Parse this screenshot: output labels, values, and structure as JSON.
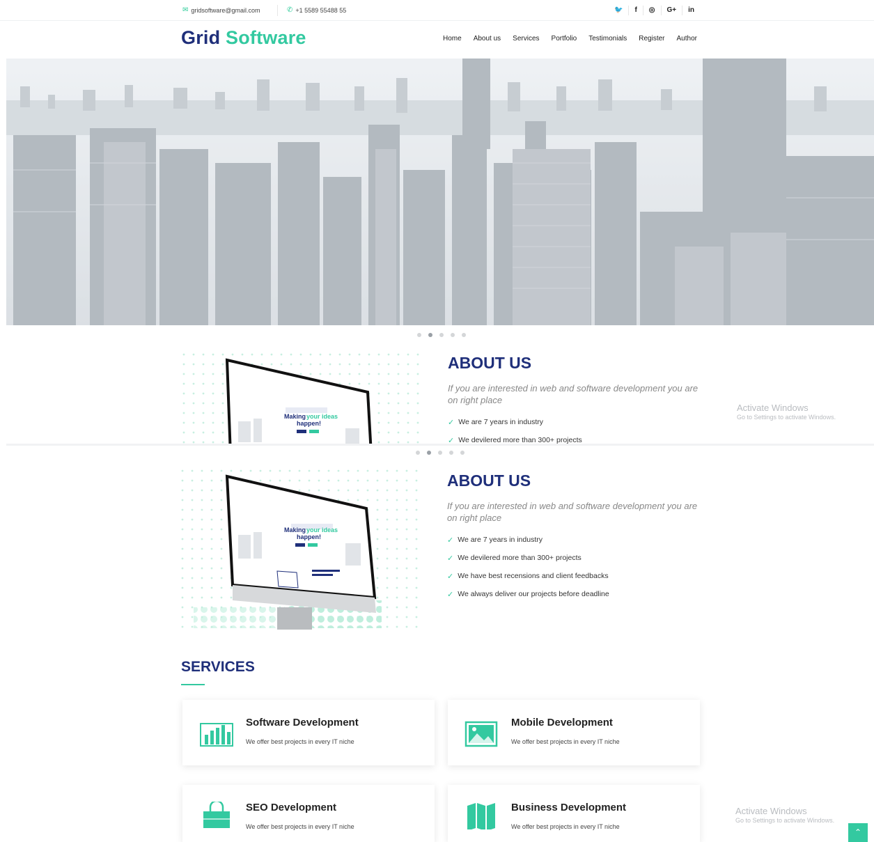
{
  "topbar": {
    "email": "gridsoftware@gmail.com",
    "phone": "+1 5589 55488 55",
    "social": [
      "twitter-icon",
      "facebook-icon",
      "instagram-icon",
      "google-plus-icon",
      "linkedin-icon"
    ],
    "social_glyphs": [
      "🐦",
      "f",
      "◎",
      "G+",
      "in"
    ]
  },
  "header": {
    "logo_part1": "Grid",
    "logo_part2": "Software",
    "nav": [
      "Home",
      "About us",
      "Services",
      "Portfolio",
      "Testimonials",
      "Register",
      "Author"
    ]
  },
  "colors": {
    "primary": "#1f2f7a",
    "accent": "#33c9a0"
  },
  "hero": {
    "slides": 5,
    "active_slide": 2
  },
  "about": {
    "title": "ABOUT US",
    "subtitle": "If you are interested in web and software development you are on right place",
    "points": [
      "We are 7 years in industry",
      "We devilered more than 300+ projects",
      "We have best recensions and client feedbacks",
      "We always deliver our projects before deadline"
    ],
    "mockup_headline_1": "Making ",
    "mockup_headline_accent": "your ideas",
    "mockup_headline_2": "happen!"
  },
  "watermark": {
    "line1": "Activate Windows",
    "line2": "Go to Settings to activate Windows."
  },
  "services": {
    "title": "SERVICES",
    "items": [
      {
        "title": "Software Development",
        "desc": "We offer best projects in every IT niche",
        "icon": "bar-chart-icon"
      },
      {
        "title": "Mobile Development",
        "desc": "We offer best projects in every IT niche",
        "icon": "image-icon"
      },
      {
        "title": "SEO Development",
        "desc": "We offer best projects in every IT niche",
        "icon": "shopping-bag-icon"
      },
      {
        "title": "Business Development",
        "desc": "We offer best projects in every IT niche",
        "icon": "map-icon"
      }
    ]
  }
}
